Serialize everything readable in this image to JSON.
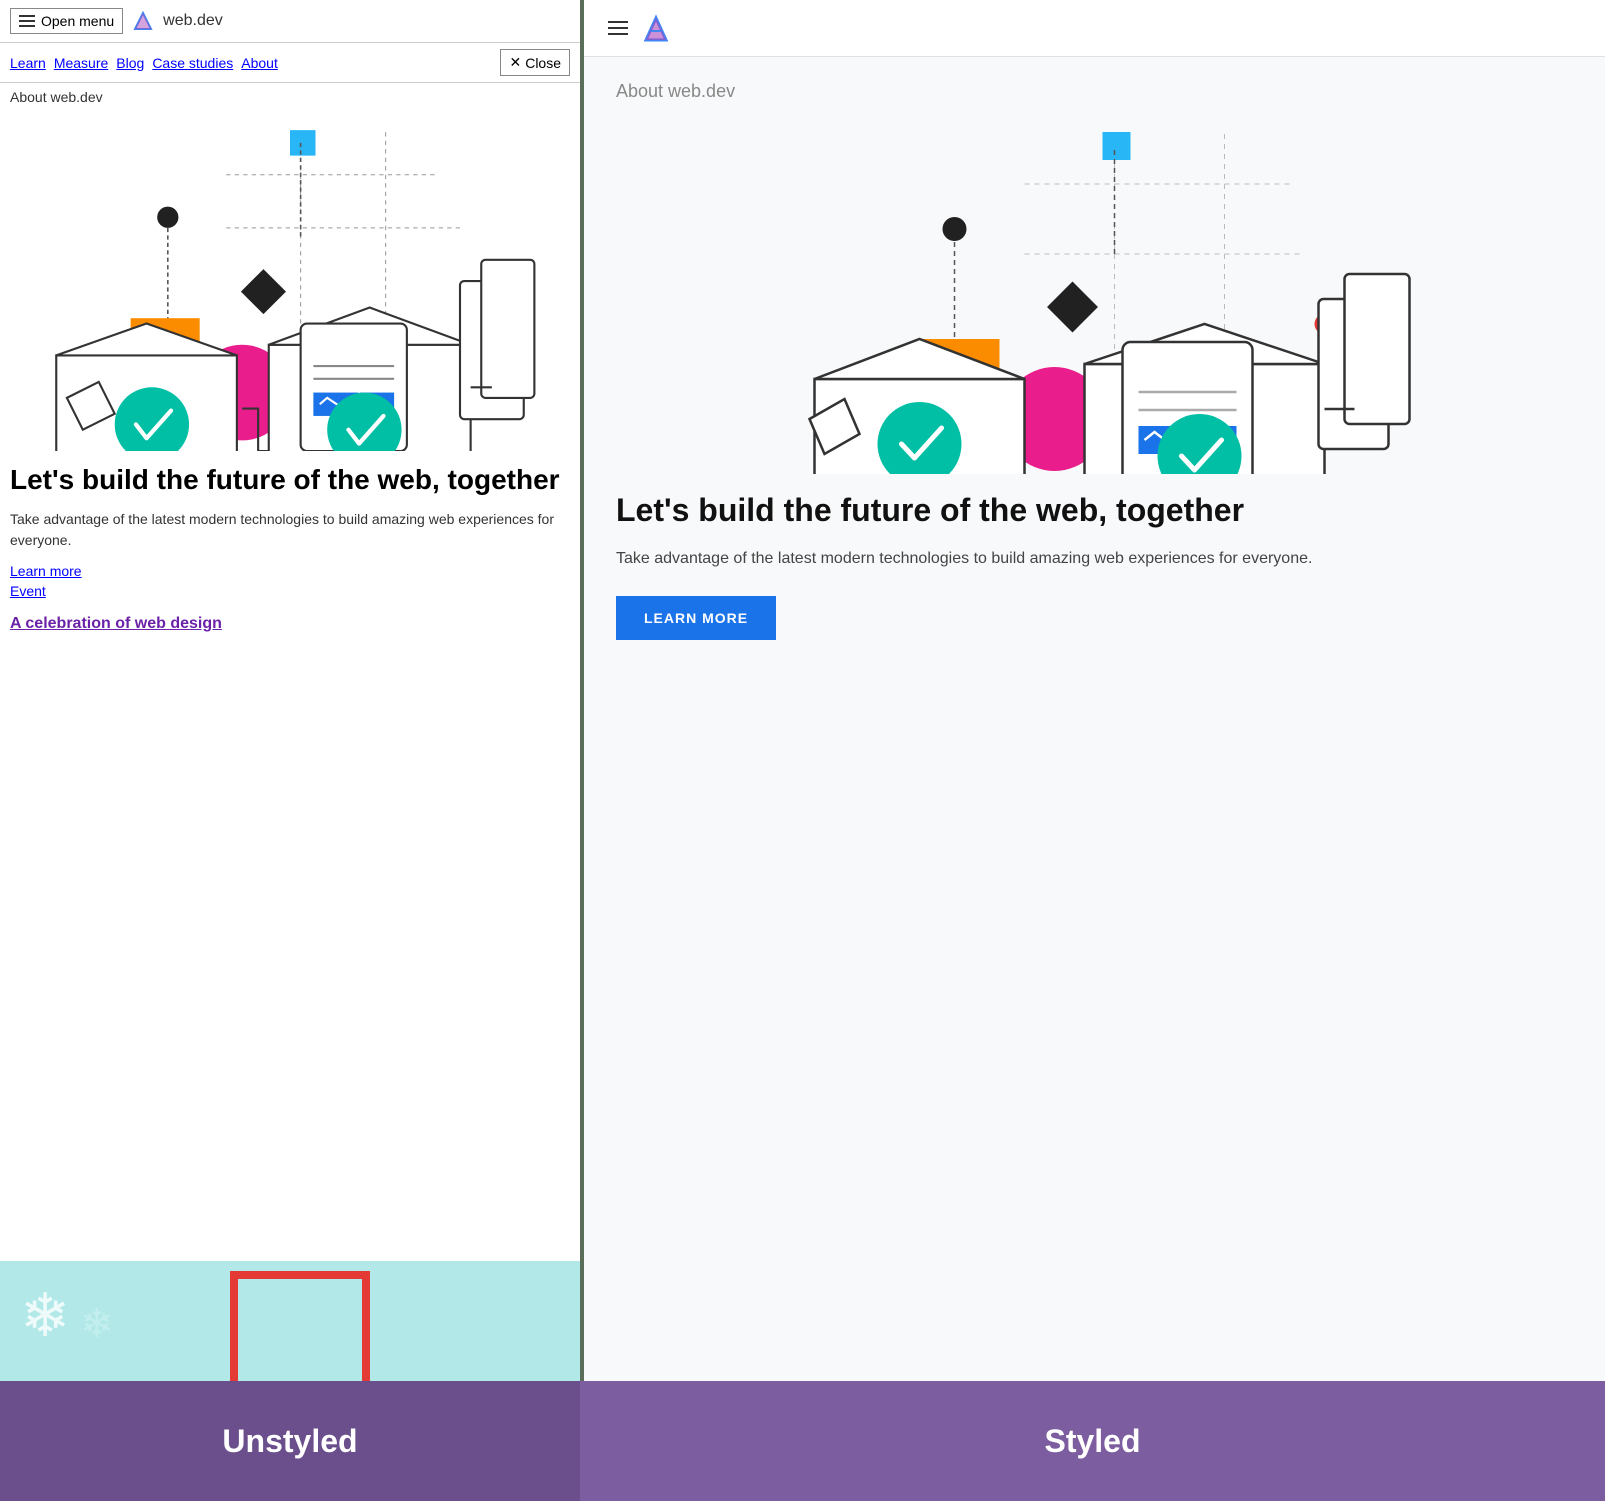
{
  "left": {
    "header": {
      "menu_label": "Open menu",
      "logo_text": "web.dev"
    },
    "nav": {
      "links": [
        "Learn",
        "Measure",
        "Blog",
        "Case studies",
        "About"
      ],
      "close_label": "Close"
    },
    "about_label": "About web.dev",
    "hero": {
      "title": "Let's build the future of the web, together",
      "description": "Take advantage of the latest modern technologies to build amazing web experiences for everyone.",
      "links": [
        {
          "label": "Learn more",
          "href": "#"
        },
        {
          "label": "Event",
          "href": "#"
        }
      ],
      "event_link": {
        "label": "A celebration of web design",
        "href": "#"
      }
    }
  },
  "right": {
    "about_label": "About web.dev",
    "hero": {
      "title": "Let's build the future of the web, together",
      "description": "Take advantage of the latest modern technologies to build amazing web experiences for everyone.",
      "cta_label": "LEARN MORE"
    }
  },
  "labels": {
    "unstyled": "Unstyled",
    "styled": "Styled"
  },
  "icons": {
    "hamburger": "☰",
    "close": "✕"
  },
  "logo": {
    "color_blue": "#4285f4",
    "color_purple": "#ab47bc"
  },
  "colors": {
    "accent_blue": "#1a73e8",
    "teal_check": "#00bfa5",
    "orange_box": "#fb8c00",
    "pink_circle": "#e91e8c",
    "cyan_square": "#29b6f6",
    "dark_diamond": "#212121"
  }
}
